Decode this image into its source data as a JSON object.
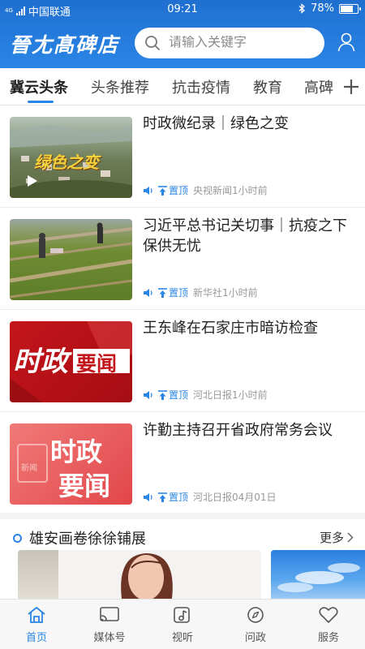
{
  "status_bar": {
    "network": "4G",
    "carrier": "中国联通",
    "time": "09:21",
    "battery": "78%",
    "battery_level": 0.78
  },
  "header": {
    "logo_text": "晉尢髙碑店",
    "search_placeholder": "请输入关键字"
  },
  "tabs": [
    {
      "label": "冀云头条",
      "active": true
    },
    {
      "label": "头条推荐",
      "active": false
    },
    {
      "label": "抗击疫情",
      "active": false
    },
    {
      "label": "教育",
      "active": false
    },
    {
      "label": "高碑",
      "active": false
    }
  ],
  "news": [
    {
      "title": "时政微纪录｜绿色之变",
      "top_label": "置顶",
      "source_time": "央视新闻1小时前",
      "thumb_text": "绿色之变"
    },
    {
      "title": "习近平总书记关切事｜抗疫之下保供无忧",
      "top_label": "置顶",
      "source_time": "新华社1小时前"
    },
    {
      "title": "王东峰在石家庄市暗访检查",
      "top_label": "置顶",
      "source_time": "河北日报1小时前",
      "thumb_text_1": "时政",
      "thumb_text_2": "要闻"
    },
    {
      "title": "许勤主持召开省政府常务会议",
      "top_label": "置顶",
      "source_time": "河北日报04月01日",
      "thumb_text_1": "时政",
      "thumb_text_2": "要闻",
      "thumb_tag": "新闻"
    }
  ],
  "section": {
    "title": "雄安画卷徐徐铺展",
    "more_label": "更多"
  },
  "bottom_nav": [
    {
      "label": "首页",
      "icon": "home-icon",
      "active": true
    },
    {
      "label": "媒体号",
      "icon": "cast-icon",
      "active": false
    },
    {
      "label": "视听",
      "icon": "music-icon",
      "active": false
    },
    {
      "label": "问政",
      "icon": "compass-icon",
      "active": false
    },
    {
      "label": "服务",
      "icon": "heart-icon",
      "active": false
    }
  ],
  "colors": {
    "brand_blue": "#2a86e6",
    "header_gradient_top": "#1f6fd0"
  }
}
